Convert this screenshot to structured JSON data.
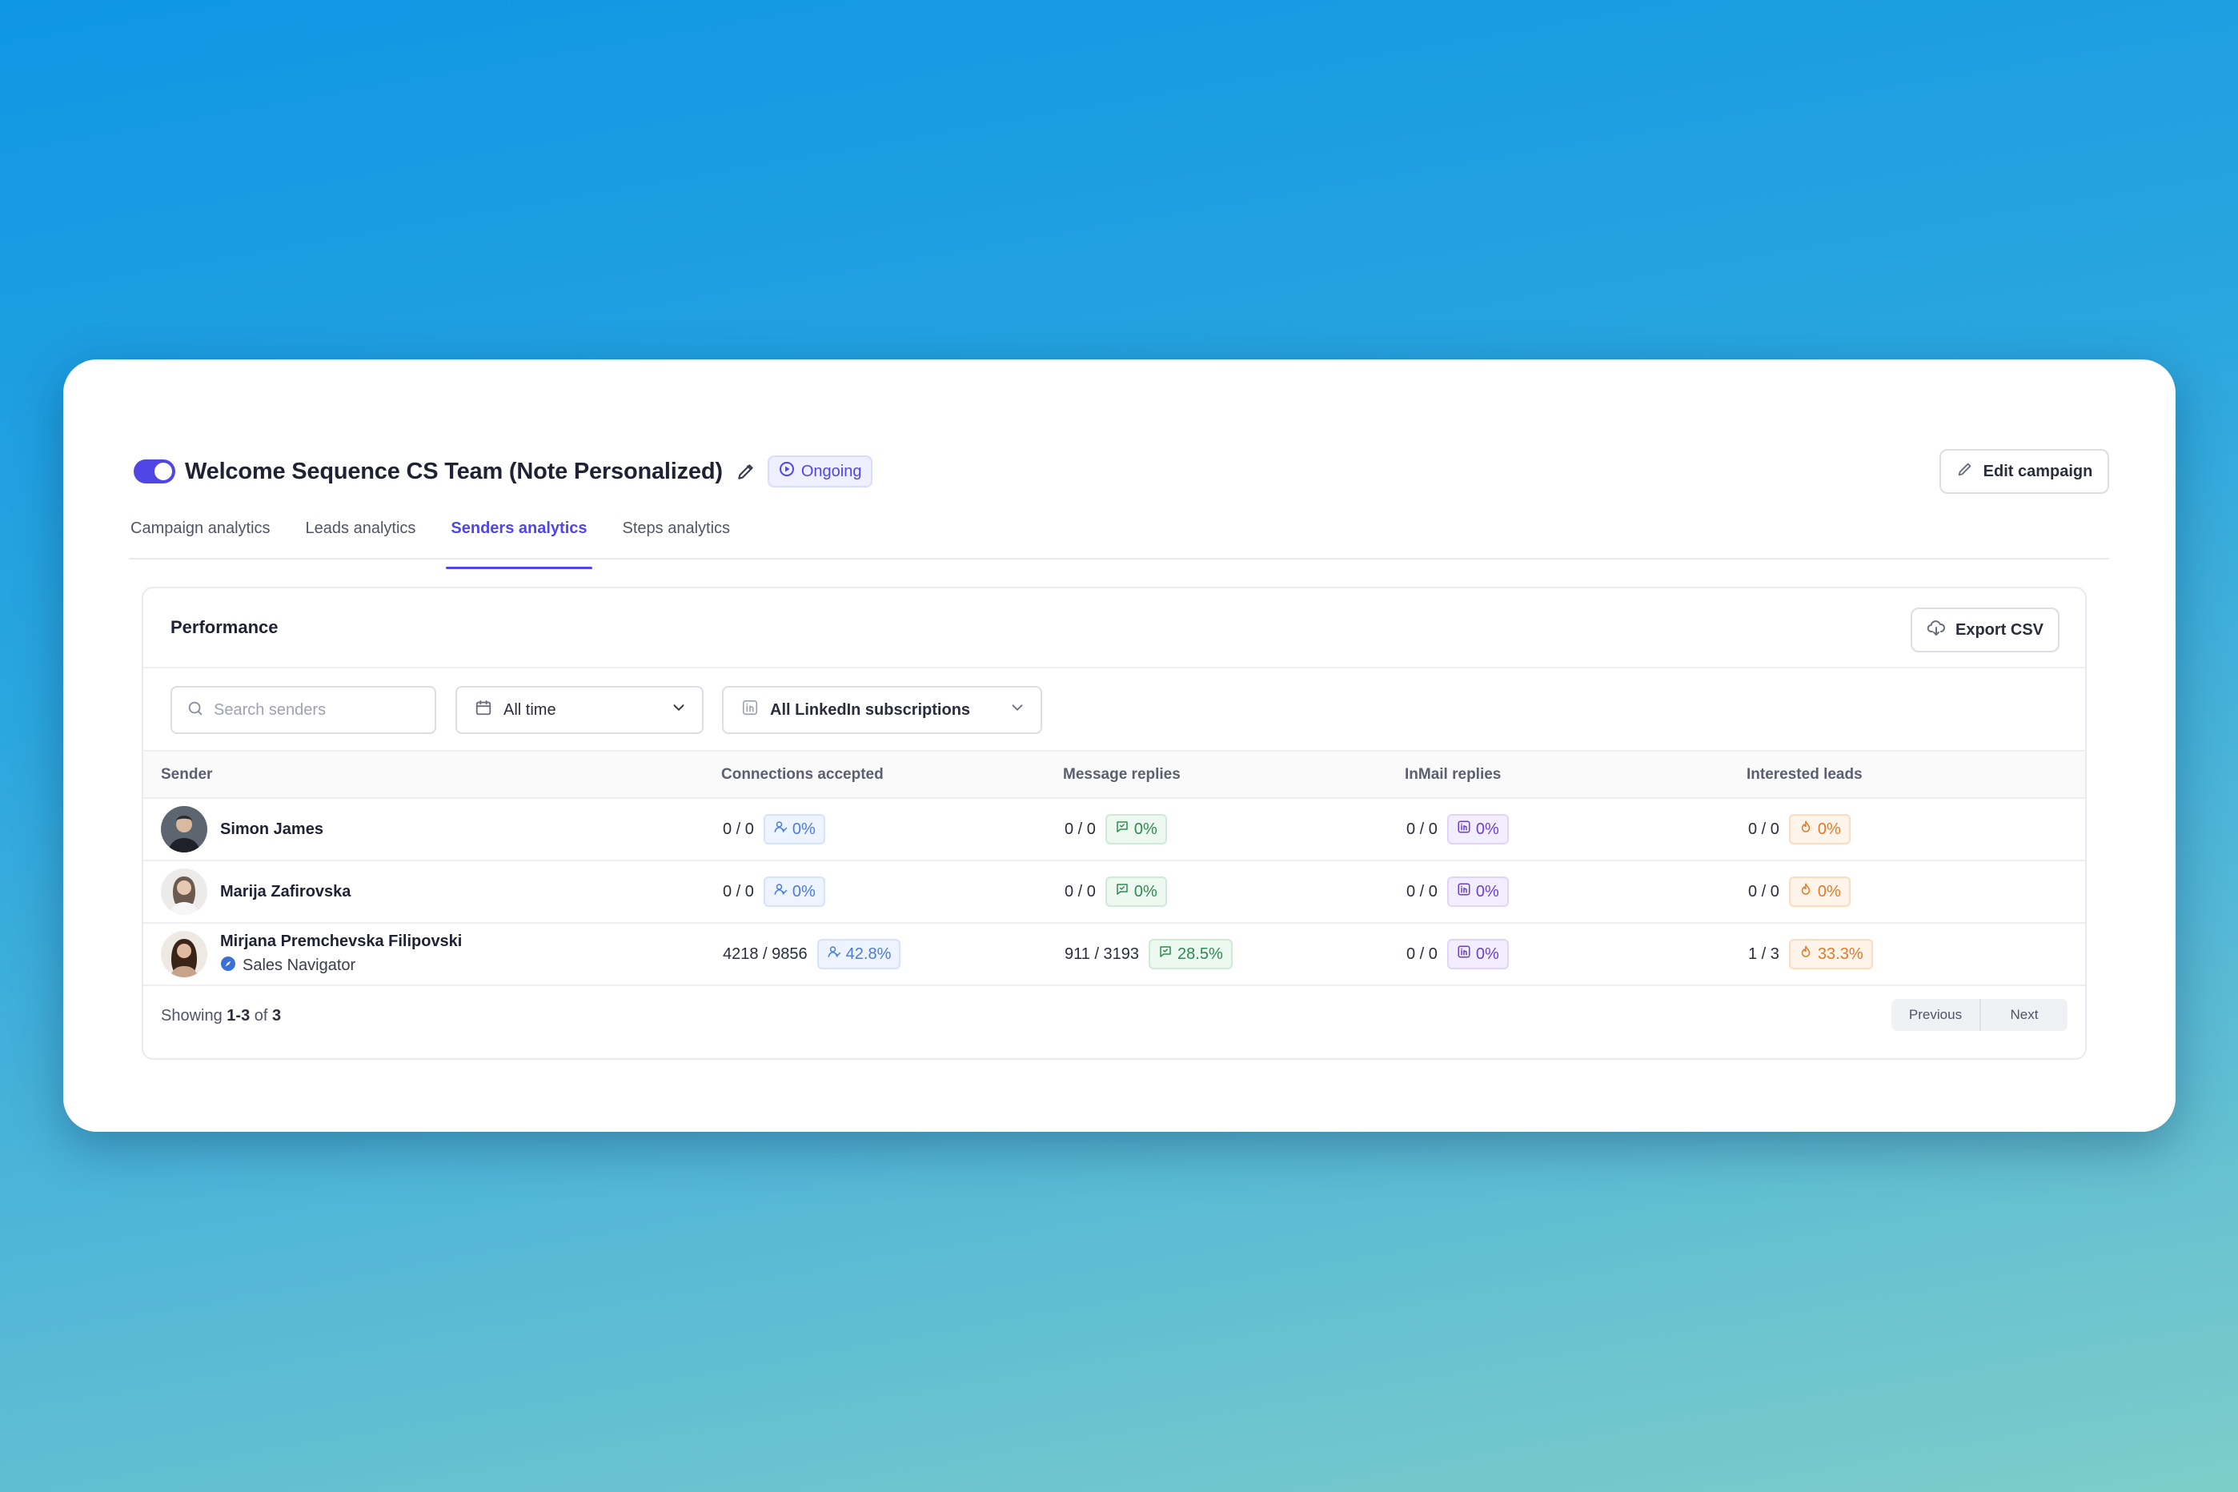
{
  "colors": {
    "accent": "#4f46e5",
    "blue": "#4a7bd6",
    "green": "#2d8a4f",
    "purple": "#6b3fc9",
    "orange": "#e07a25"
  },
  "header": {
    "campaign_title": "Welcome Sequence CS Team (Note Personalized)",
    "status_badge": "Ongoing",
    "edit_button": "Edit campaign",
    "toggle_on": true
  },
  "tabs": [
    {
      "label": "Campaign analytics",
      "active": false
    },
    {
      "label": "Leads analytics",
      "active": false
    },
    {
      "label": "Senders analytics",
      "active": true
    },
    {
      "label": "Steps analytics",
      "active": false
    }
  ],
  "panel": {
    "title": "Performance",
    "export_button": "Export CSV"
  },
  "filters": {
    "search_placeholder": "Search senders",
    "search_value": "",
    "time_selected": "All time",
    "subscription_selected": "All LinkedIn subscriptions"
  },
  "table": {
    "columns": [
      "Sender",
      "Connections accepted",
      "Message replies",
      "InMail replies",
      "Interested leads"
    ],
    "rows": [
      {
        "name": "Simon James",
        "subtitle": "",
        "connections": {
          "ratio": "0 / 0",
          "pct": "0%"
        },
        "messages": {
          "ratio": "0 / 0",
          "pct": "0%"
        },
        "inmail": {
          "ratio": "0 / 0",
          "pct": "0%"
        },
        "interested": {
          "ratio": "0 / 0",
          "pct": "0%"
        }
      },
      {
        "name": "Marija Zafirovska",
        "subtitle": "",
        "connections": {
          "ratio": "0 / 0",
          "pct": "0%"
        },
        "messages": {
          "ratio": "0 / 0",
          "pct": "0%"
        },
        "inmail": {
          "ratio": "0 / 0",
          "pct": "0%"
        },
        "interested": {
          "ratio": "0 / 0",
          "pct": "0%"
        }
      },
      {
        "name": "Mirjana Premchevska Filipovski",
        "subtitle": "Sales Navigator",
        "connections": {
          "ratio": "4218 / 9856",
          "pct": "42.8%"
        },
        "messages": {
          "ratio": "911 / 3193",
          "pct": "28.5%"
        },
        "inmail": {
          "ratio": "0 / 0",
          "pct": "0%"
        },
        "interested": {
          "ratio": "1 / 3",
          "pct": "33.3%"
        }
      }
    ]
  },
  "footer": {
    "showing_prefix": "Showing",
    "showing_range": "1-3",
    "showing_of": "of",
    "showing_total": "3",
    "previous": "Previous",
    "next": "Next"
  }
}
